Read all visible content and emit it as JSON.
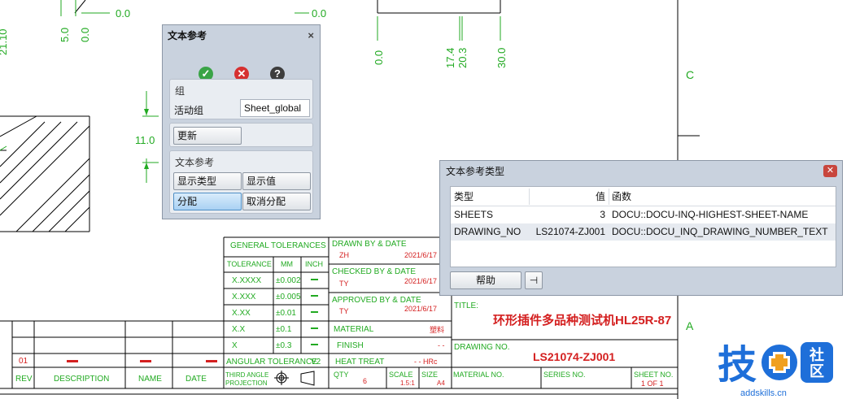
{
  "drawing": {
    "dims": [
      "0.0",
      "5.0",
      "0.0",
      "0.0",
      "0.0",
      "17.4",
      "20.3",
      "30.0",
      "11.0"
    ],
    "top_left_partial": "21.10",
    "zone_c": "C",
    "zone_a": "A",
    "tol": {
      "title": "GENERAL TOLERANCES",
      "h_tolerance": "TOLERANCE",
      "h_mm": "MM",
      "h_inch": "INCH",
      "rows": [
        {
          "label": "X.XXXX",
          "mm": "±0.002"
        },
        {
          "label": "X.XXX",
          "mm": "±0.005"
        },
        {
          "label": "X.XX",
          "mm": "±0.01"
        },
        {
          "label": "X.X",
          "mm": "±0.1"
        },
        {
          "label": "X",
          "mm": "±0.3"
        }
      ],
      "angular": "ANGULAR TOLERANCE",
      "v2": "V2",
      "projection_1": "THIRD ANGLE",
      "projection_2": "PROJECTION"
    },
    "sign": {
      "drawn": "DRAWN BY & DATE",
      "drawn_by": "ZH",
      "drawn_date": "2021/6/17",
      "checked": "CHECKED BY & DATE",
      "checked_by": "TY",
      "checked_date": "2021/6/17",
      "approved": "APPROVED BY & DATE",
      "approved_by": "TY",
      "approved_date": "2021/6/17",
      "material": "MATERIAL",
      "material_val": "塑料",
      "finish": "FINISH",
      "finish_val": "- -",
      "heat": "HEAT TREAT",
      "heat_val": "- - HRc",
      "qty": "QTY",
      "qty_val": "6",
      "scale": "SCALE",
      "scale_val": "1.5:1",
      "size": "SIZE",
      "size_val": "A4"
    },
    "title_label": "TITLE:",
    "title_value": "环形插件多品种测试机HL25R-87",
    "drawing_no_label": "DRAWING NO.",
    "drawing_no_value": "LS21074-ZJ001",
    "material_no": "MATERIAL NO.",
    "series_no": "SERIES NO.",
    "sheet_no": "SHEET NO.",
    "sheet_val": "1 OF 1",
    "rev": {
      "row_num": "01",
      "h_rev": "REV",
      "h_desc": "DESCRIPTION",
      "h_name": "NAME",
      "h_date": "DATE"
    }
  },
  "dialog_ref": {
    "title": "文本参考",
    "close": "×",
    "ok_icon": "check-icon",
    "cancel_icon": "cancel-icon",
    "help_icon": "help-icon",
    "group_header": "组",
    "active_group_label": "活动组",
    "active_group_value": "Sheet_global",
    "update_button": "更新",
    "text_ref_header": "文本参考",
    "show_type": "显示类型",
    "show_value": "显示值",
    "assign": "分配",
    "unassign": "取消分配"
  },
  "dialog_types": {
    "title": "文本参考类型",
    "columns": [
      "类型",
      "值",
      "函数"
    ],
    "rows": [
      {
        "type": "SHEETS",
        "value": "3",
        "func": "DOCU::DOCU-INQ-HIGHEST-SHEET-NAME"
      },
      {
        "type": "DRAWING_NO",
        "value": "LS21074-ZJ001",
        "func": "DOCU::DOCU_INQ_DRAWING_NUMBER_TEXT"
      }
    ],
    "help_button": "帮助",
    "pin_icon": "pin-icon"
  },
  "logo": {
    "main": "技",
    "badge": "社区",
    "site": "addskills.cn",
    "accent": "#1e6fd9",
    "plus_color": "#f0a020"
  }
}
